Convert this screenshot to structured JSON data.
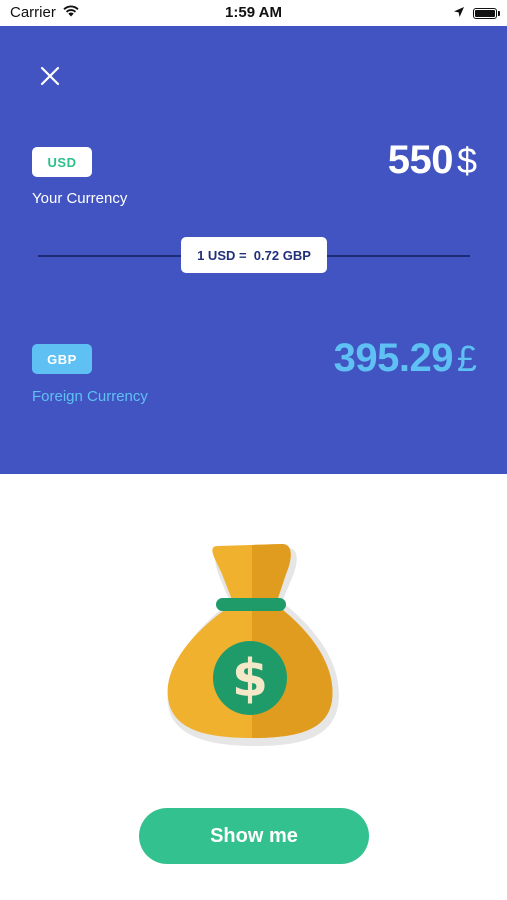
{
  "status_bar": {
    "carrier": "Carrier",
    "time": "1:59 AM",
    "battery_level": 0.9
  },
  "converter": {
    "close_icon": "close-icon",
    "source": {
      "code": "USD",
      "label": "Your Currency",
      "amount": "550",
      "symbol": "$"
    },
    "rate": {
      "text": "1 USD =  0.72 GBP"
    },
    "target": {
      "code": "GBP",
      "label": "Foreign Currency",
      "amount": "395.29",
      "symbol": "£"
    }
  },
  "illustration": {
    "icon": "money-bag-icon",
    "glyph": "$"
  },
  "cta": {
    "label": "Show me"
  },
  "colors": {
    "panel": "#4154c2",
    "accent_green": "#33c28f",
    "accent_blue": "#5fc0f4",
    "bag": "#f0b12f",
    "coin": "#1f9b6a"
  }
}
